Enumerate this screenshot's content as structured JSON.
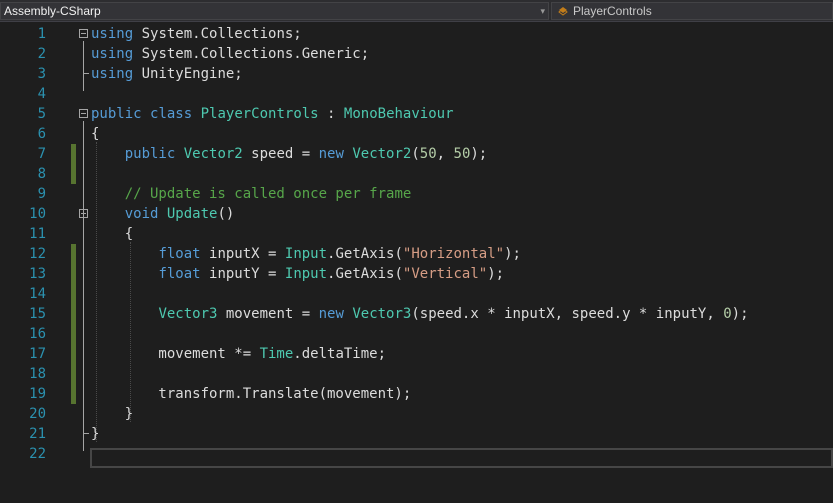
{
  "navbar": {
    "project_dropdown": "Assembly-CSharp",
    "type_dropdown": "PlayerControls",
    "type_icon": "class-icon"
  },
  "editor": {
    "line_numbers": [
      "1",
      "2",
      "3",
      "4",
      "5",
      "6",
      "7",
      "8",
      "9",
      "10",
      "11",
      "12",
      "13",
      "14",
      "15",
      "16",
      "17",
      "18",
      "19",
      "20",
      "21",
      "22"
    ],
    "lines": [
      [
        [
          "kw",
          "using"
        ],
        [
          "pl",
          " System.Collections;"
        ]
      ],
      [
        [
          "kw",
          "using"
        ],
        [
          "pl",
          " System.Collections.Generic;"
        ]
      ],
      [
        [
          "kw",
          "using"
        ],
        [
          "pl",
          " UnityEngine;"
        ]
      ],
      [],
      [
        [
          "kw",
          "public"
        ],
        [
          "pl",
          " "
        ],
        [
          "kw",
          "class"
        ],
        [
          "pl",
          " "
        ],
        [
          "ty",
          "PlayerControls"
        ],
        [
          "pl",
          " : "
        ],
        [
          "ty",
          "MonoBehaviour"
        ]
      ],
      [
        [
          "pl",
          "{"
        ]
      ],
      [
        [
          "pl",
          "    "
        ],
        [
          "kw",
          "public"
        ],
        [
          "pl",
          " "
        ],
        [
          "ty",
          "Vector2"
        ],
        [
          "pl",
          " speed = "
        ],
        [
          "kw",
          "new"
        ],
        [
          "pl",
          " "
        ],
        [
          "ty",
          "Vector2"
        ],
        [
          "pl",
          "("
        ],
        [
          "nu",
          "50"
        ],
        [
          "pl",
          ", "
        ],
        [
          "nu",
          "50"
        ],
        [
          "pl",
          ");"
        ]
      ],
      [],
      [
        [
          "pl",
          "    "
        ],
        [
          "cm",
          "// Update is called once per frame"
        ]
      ],
      [
        [
          "pl",
          "    "
        ],
        [
          "kw",
          "void"
        ],
        [
          "pl",
          " "
        ],
        [
          "ty",
          "Update"
        ],
        [
          "pl",
          "()"
        ]
      ],
      [
        [
          "pl",
          "    {"
        ]
      ],
      [
        [
          "pl",
          "        "
        ],
        [
          "kw",
          "float"
        ],
        [
          "pl",
          " inputX = "
        ],
        [
          "ty",
          "Input"
        ],
        [
          "pl",
          ".GetAxis("
        ],
        [
          "st",
          "\"Horizontal\""
        ],
        [
          "pl",
          ");"
        ]
      ],
      [
        [
          "pl",
          "        "
        ],
        [
          "kw",
          "float"
        ],
        [
          "pl",
          " inputY = "
        ],
        [
          "ty",
          "Input"
        ],
        [
          "pl",
          ".GetAxis("
        ],
        [
          "st",
          "\"Vertical\""
        ],
        [
          "pl",
          ");"
        ]
      ],
      [],
      [
        [
          "pl",
          "        "
        ],
        [
          "ty",
          "Vector3"
        ],
        [
          "pl",
          " movement = "
        ],
        [
          "kw",
          "new"
        ],
        [
          "pl",
          " "
        ],
        [
          "ty",
          "Vector3"
        ],
        [
          "pl",
          "(speed.x * inputX, speed.y * inputY, "
        ],
        [
          "nu",
          "0"
        ],
        [
          "pl",
          ");"
        ]
      ],
      [],
      [
        [
          "pl",
          "        movement *= "
        ],
        [
          "ty",
          "Time"
        ],
        [
          "pl",
          ".deltaTime;"
        ]
      ],
      [],
      [
        [
          "pl",
          "        transform.Translate(movement);"
        ]
      ],
      [
        [
          "pl",
          "    }"
        ]
      ],
      [
        [
          "pl",
          "}"
        ]
      ],
      []
    ],
    "changed_lines": [
      7,
      8,
      12,
      13,
      14,
      15,
      16,
      17,
      18,
      19
    ],
    "collapse_markers": [
      1,
      5,
      10
    ],
    "current_line": 22,
    "colors": {
      "background": "#1e1e1e",
      "line_number": "#2b91af",
      "keyword": "#569cd6",
      "type": "#4ec9b0",
      "string": "#d69d85",
      "number": "#b5cea8",
      "comment": "#57a64a",
      "text": "#dcdcdc",
      "change_bar": "#577430"
    }
  }
}
